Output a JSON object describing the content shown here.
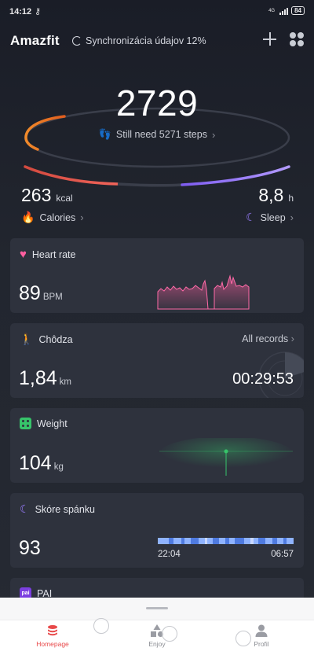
{
  "status_bar": {
    "time": "14:12",
    "network": "4G",
    "battery": "84"
  },
  "header": {
    "app_title": "Amazfit",
    "sync_text": "Synchronizácia údajov 12%"
  },
  "dial": {
    "steps": "2729",
    "still_need": "Still need 5271 steps",
    "step_progress": 0.34,
    "calories_value": "263",
    "calories_unit": "kcal",
    "calories_label": "Calories",
    "sleep_value": "8,8",
    "sleep_unit": "h",
    "sleep_label": "Sleep"
  },
  "cards": {
    "heart": {
      "title": "Heart rate",
      "value": "89",
      "unit": "BPM"
    },
    "walk": {
      "title": "Chôdza",
      "link": "All records",
      "value": "1,84",
      "unit": "km",
      "duration": "00:29:53"
    },
    "weight": {
      "title": "Weight",
      "value": "104",
      "unit": "kg"
    },
    "sleep": {
      "title": "Skóre spánku",
      "value": "93",
      "start": "22:04",
      "end": "06:57"
    },
    "pai": {
      "title": "PAI",
      "icon_text": "pai"
    }
  },
  "tabs": {
    "home": "Homepage",
    "enjoy": "Enjoy",
    "profile": "Profil"
  },
  "colors": {
    "accent_orange": "#f08a2a",
    "calories_red": "#ef5a3f",
    "sleep_purple": "#9a7dff",
    "heart_pink": "#ff5fa0",
    "weight_green": "#37c46a",
    "tab_active": "#e8494a"
  }
}
